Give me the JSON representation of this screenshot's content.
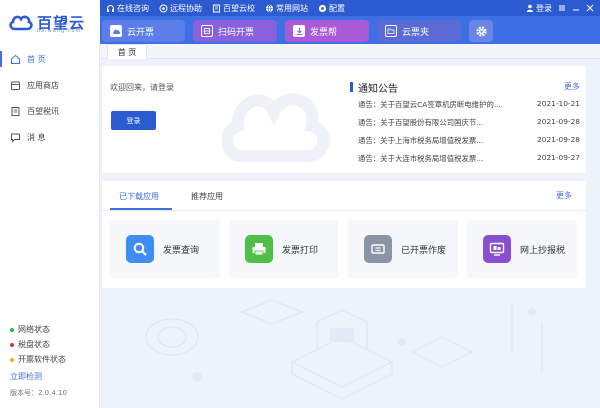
{
  "logo": {
    "name": "百望云",
    "sub": "baiwang.com"
  },
  "toplinks": [
    {
      "icon": "headset-icon",
      "label": "在线咨询"
    },
    {
      "icon": "remote-icon",
      "label": "远程协助"
    },
    {
      "icon": "book-icon",
      "label": "百望云校"
    },
    {
      "icon": "globe-icon",
      "label": "常用网站"
    },
    {
      "icon": "config-icon",
      "label": "配置"
    }
  ],
  "topright": {
    "login": "登录"
  },
  "quickbuttons": [
    {
      "label": "云开票",
      "color": "#5b7ee8"
    },
    {
      "label": "扫码开票",
      "color": "#8a61dd"
    },
    {
      "label": "发票帮",
      "color": "#a95ad8"
    },
    {
      "label": "云票夹",
      "color": "#5a6bd6"
    }
  ],
  "sidebar": {
    "items": [
      {
        "label": "首 页",
        "icon": "home-icon"
      },
      {
        "label": "应用商店",
        "icon": "store-icon"
      },
      {
        "label": "百望税讯",
        "icon": "news-icon"
      },
      {
        "label": "消 息",
        "icon": "message-icon"
      }
    ],
    "status": [
      {
        "label": "网络状态",
        "color": "#27b84a"
      },
      {
        "label": "税盘状态",
        "color": "#e0302f"
      },
      {
        "label": "开票软件状态",
        "color": "#f0b020"
      }
    ],
    "check": "立即检测",
    "version": "版本号：2.0.4.10"
  },
  "tabs": {
    "home": "首 页"
  },
  "welcome": {
    "text": "欢迎回来，请登录",
    "login_button": "登录"
  },
  "notice": {
    "title": "通知公告",
    "more": "更多",
    "items": [
      {
        "text": "通告：关于百望云CA签章机房断电维护的...",
        "date": "2021-10-21"
      },
      {
        "text": "通告：关于百望股份有限公司国庆节...",
        "date": "2021-09-28"
      },
      {
        "text": "通告：关于上海市税务局增值税发票...",
        "date": "2021-09-28"
      },
      {
        "text": "通告：关于大连市税务局增值税发票...",
        "date": "2021-09-27"
      }
    ]
  },
  "apps": {
    "tab_downloaded": "已下载应用",
    "tab_recommended": "推荐应用",
    "more": "更多",
    "items": [
      {
        "label": "发票查询",
        "color": "#3d8ef0",
        "icon": "search-icon"
      },
      {
        "label": "发票打印",
        "color": "#4fbf4a",
        "icon": "printer-icon"
      },
      {
        "label": "已开票作废",
        "color": "#8a94a6",
        "icon": "void-ticket-icon"
      },
      {
        "label": "网上抄报税",
        "color": "#8a4fd0",
        "icon": "tax-report-icon"
      }
    ]
  }
}
